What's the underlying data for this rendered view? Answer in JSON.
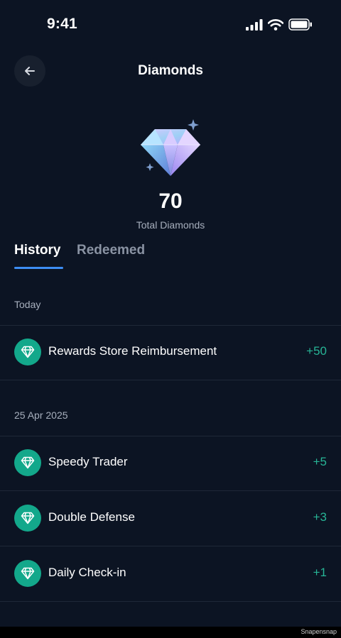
{
  "status_bar": {
    "time": "9:41"
  },
  "header": {
    "title": "Diamonds"
  },
  "summary": {
    "total_value": "70",
    "total_label": "Total Diamonds"
  },
  "tabs": [
    {
      "label": "History",
      "active": true
    },
    {
      "label": "Redeemed",
      "active": false
    }
  ],
  "sections": [
    {
      "date": "Today",
      "items": [
        {
          "title": "Rewards Store Reimbursement",
          "amount": "+50"
        }
      ]
    },
    {
      "date": "25 Apr 2025",
      "items": [
        {
          "title": "Speedy Trader",
          "amount": "+5"
        },
        {
          "title": "Double Defense",
          "amount": "+3"
        },
        {
          "title": "Daily Check-in",
          "amount": "+1"
        }
      ]
    }
  ],
  "footer": {
    "watermark": "Snapensnap"
  },
  "colors": {
    "background": "#0c1423",
    "accent": "#3d8ef5",
    "positive": "#27b596",
    "badge": "#13a88b"
  },
  "icons": [
    "back-arrow-icon",
    "diamond-icon",
    "signal-icon",
    "wifi-icon",
    "battery-icon",
    "sparkle-icon"
  ]
}
